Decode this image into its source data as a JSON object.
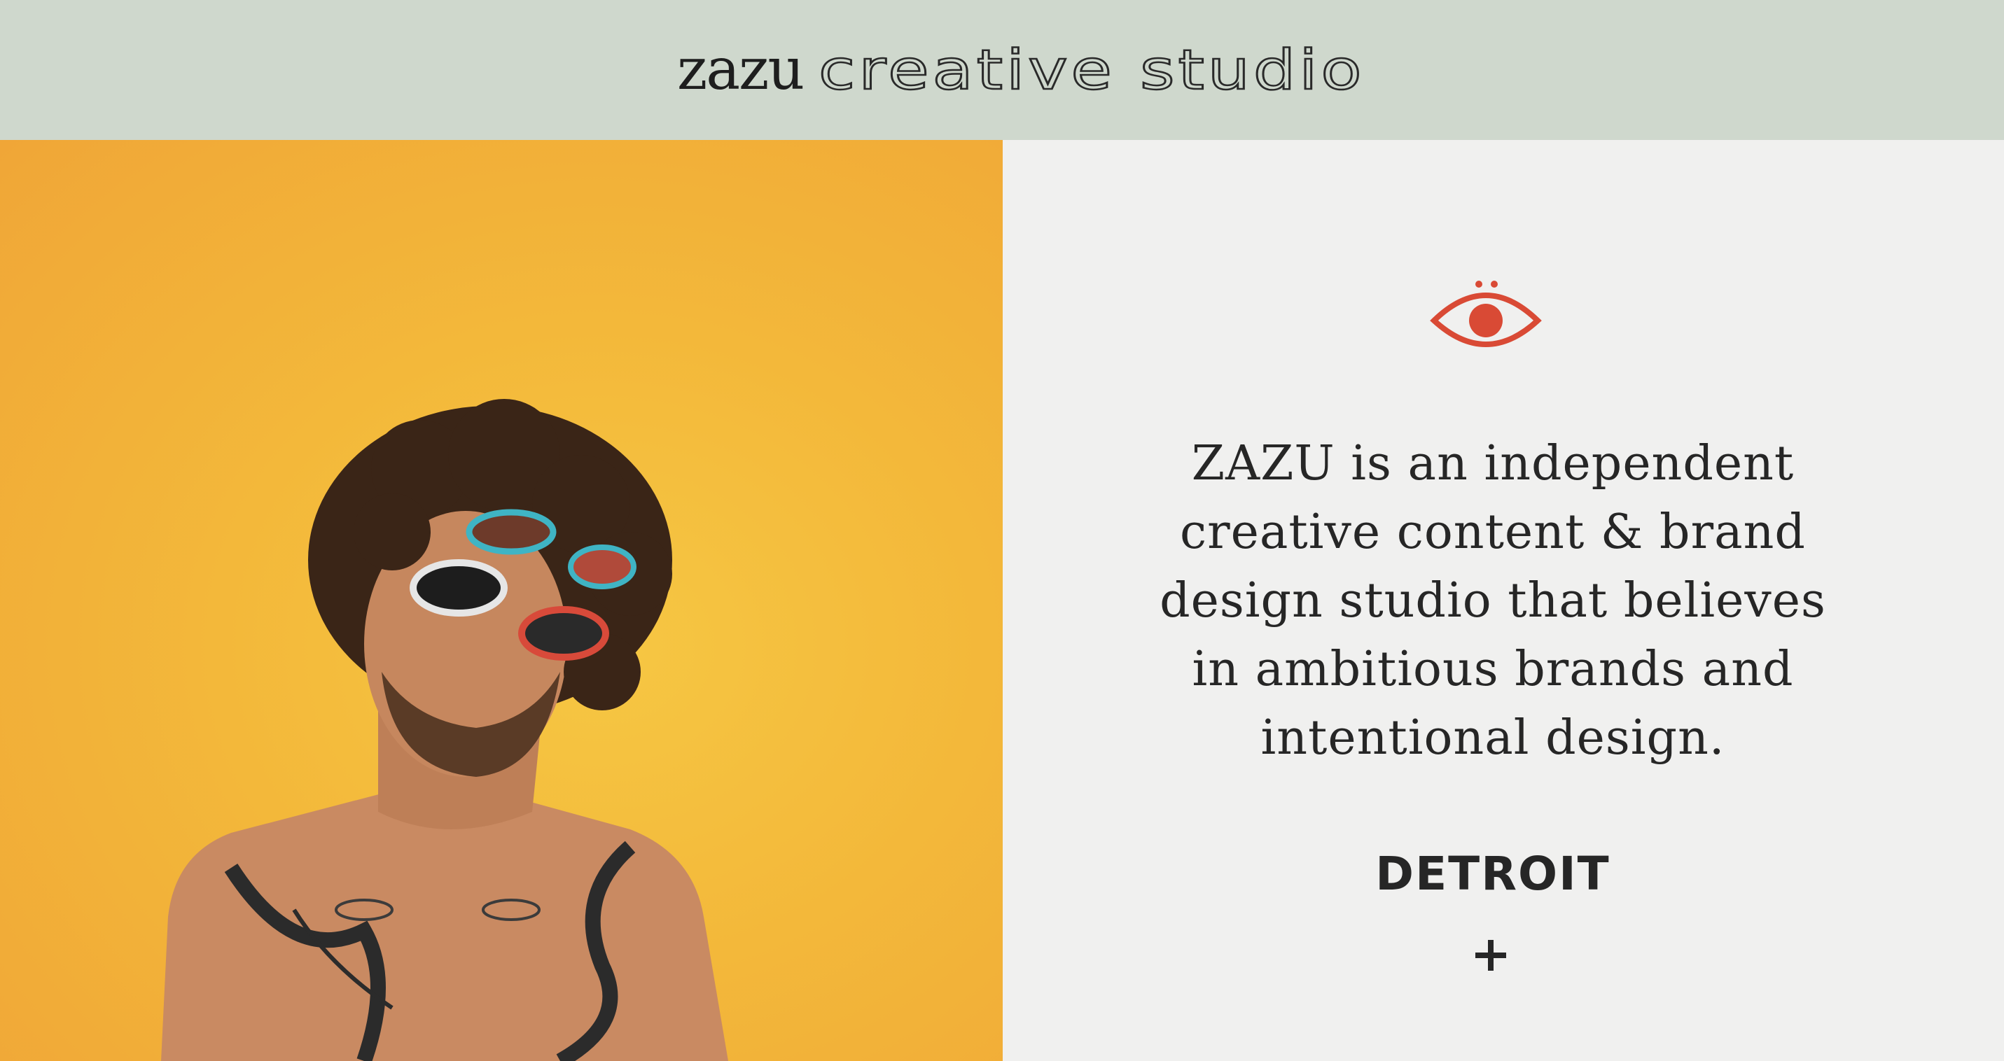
{
  "header": {
    "logo_mark": "zazu",
    "logo_subtitle": "creative studio",
    "background_color": "#cfd8cd"
  },
  "hero": {
    "background_color": "#f3b83a"
  },
  "about": {
    "icon": "eye-icon",
    "icon_color": "#d94a35",
    "intro_text": "ZAZU is an independent creative content & brand design studio that believes in ambitious brands and intentional design.",
    "location": "DETROIT",
    "more_icon": "plus-icon"
  }
}
